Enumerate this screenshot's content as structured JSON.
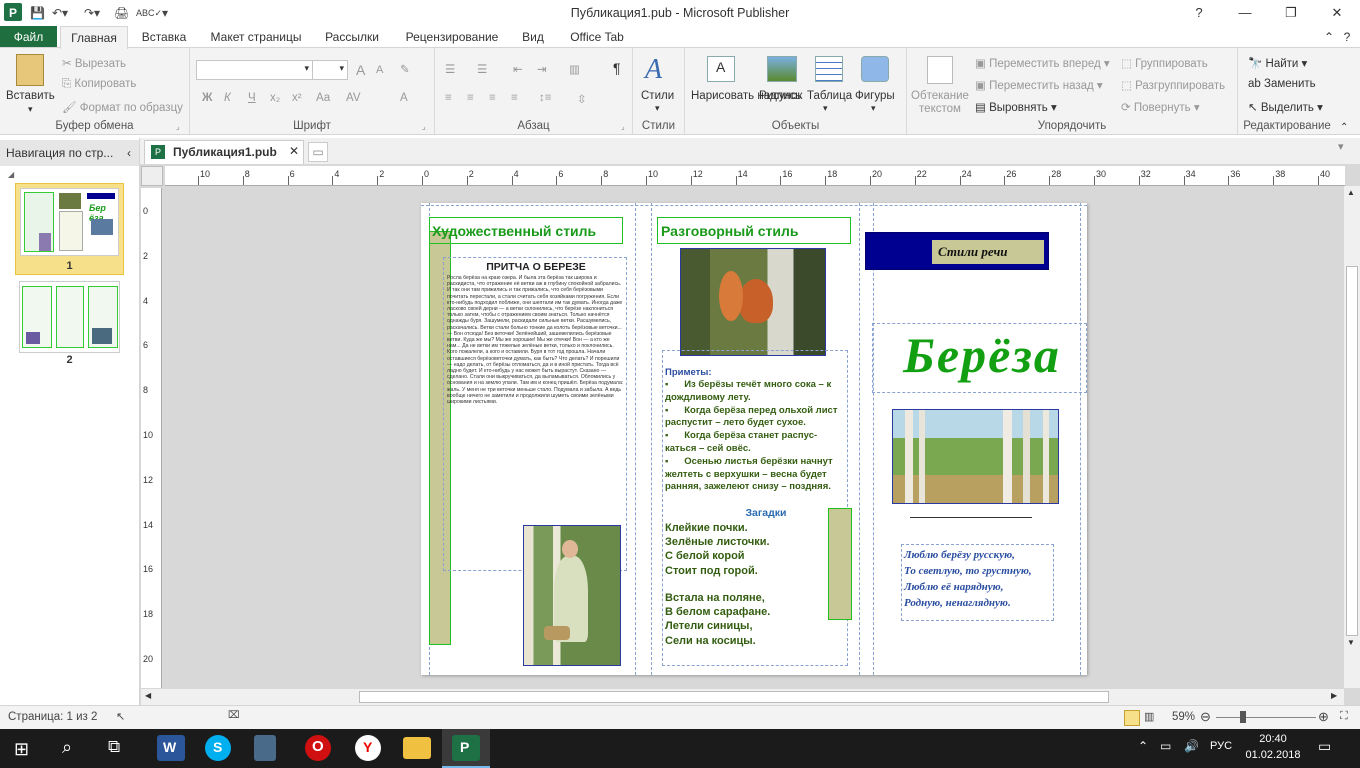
{
  "window": {
    "title": "Публикация1.pub  -  Microsoft Publisher",
    "controls": {
      "help": "?",
      "minimize": "—",
      "restore": "❐",
      "close": "✕"
    }
  },
  "ribbon_tabs": [
    "Файл",
    "Главная",
    "Вставка",
    "Макет страницы",
    "Рассылки",
    "Рецензирование",
    "Вид",
    "Office Tab"
  ],
  "ribbon": {
    "clipboard": {
      "paste": "Вставить",
      "cut": "Вырезать",
      "copy": "Копировать",
      "format_painter": "Формат по образцу",
      "label": "Буфер обмена"
    },
    "font": {
      "label": "Шрифт",
      "bold": "Ж",
      "italic": "К",
      "underline": "Ч",
      "subscript": "x₂",
      "superscript": "x²",
      "case": "Аа",
      "grow": "A",
      "shrink": "A"
    },
    "paragraph": {
      "label": "Абзац",
      "pilcrow": "¶"
    },
    "styles": {
      "label": "Стили",
      "button": "Стили"
    },
    "objects": {
      "label": "Объекты",
      "draw_text": "Нарисовать надпись",
      "picture": "Рисунок",
      "table": "Таблица",
      "shapes": "Фигуры"
    },
    "arrange": {
      "label": "Упорядочить",
      "wrap_text": "Обтекание текстом",
      "bring_forward": "Переместить вперед",
      "send_backward": "Переместить назад",
      "align": "Выровнять",
      "group": "Группировать",
      "ungroup": "Разгруппировать",
      "rotate": "Повернуть"
    },
    "editing": {
      "label": "Редактирование",
      "find": "Найти",
      "replace": "Заменить",
      "select": "Выделить"
    }
  },
  "nav_pane": {
    "title": "Навигация по стр...",
    "pages": [
      "1",
      "2"
    ]
  },
  "doc_tab": "Публикация1.pub",
  "hruler_ticks": [
    "10",
    "8",
    "6",
    "4",
    "2",
    "0",
    "2",
    "4",
    "6",
    "8",
    "10",
    "12",
    "14",
    "16",
    "18",
    "20",
    "22",
    "24",
    "26",
    "28",
    "30",
    "32",
    "34",
    "36",
    "38",
    "40"
  ],
  "vruler_ticks": [
    "0",
    "2",
    "4",
    "6",
    "8",
    "10",
    "12",
    "14",
    "16",
    "18",
    "20"
  ],
  "page": {
    "col1": {
      "header": "Художественный стиль",
      "story_title": "ПРИТЧА О БЕРЕЗЕ",
      "story_text": "Росла берёза на краю озера. И была эта берёза так широка и раскидиста, что отражение её ветви аж в глубину спокойной забрались. И так они там прижились и так прижались, что себя берёзовыми почитать перестали, а стали считать себя хозяйками погружения. Если кто-нибудь подходил поближе, они шептали им так думать. Иногда даже ласково своей дерни — а ветки склонились, что берёзе наклониться только затем, чтобы с отражением своим знаться. Только начнётся однажды буря. Зашумели, раскидали сильные ветки. Расшумелись, раскачались. Ветки стали больно тонкие да колоть берёзовые веточки... — Вон отсюда! Без веточки! Зелёнейший, зашевелились берёзовые ветви. Куда же мы? Мы же хорошие! Мы же отечки! Вон — а кто же нам... Да не ветки им тяжелые зелёные ветки, только и поклонились. Кого пожалели, а кого и оставили. Буря в тот год прошла. Начали оставшиеся берёзоветочки думать, как быть? Что делать? И порешили — надо делать, от берёзы отломаться, да и в иной пристать. Тогда всё ладно будет. И кто-нибудь у нас может быть вырастут. Сказано — сделано. Стали они выкручиваться, да выламываться. Обломились у основания и на землю упали. Там им и конец пришёл. Берёза подумала: жаль. У меня не три веточки меньше стало. Подумала и забыла. А ведь вообще ничего не заметили и продолжили шуметь своими зелёными широкими листьями."
    },
    "col2": {
      "header": "Разговорный стиль",
      "signs_title": "Приметы:",
      "signs": [
        "Из берёзы течёт много сока – к дождливому лету.",
        "Когда берёза перед ольхой лист распустит – лето будет сухое.",
        "Когда берёза станет распус-каться – сей овёс.",
        "Осенью листья берёзки начнут желтеть с верхушки – весна будет ранняя, зажелеют снизу – поздняя."
      ],
      "riddles_title": "Загадки",
      "riddle1": [
        "Клейкие почки.",
        "Зелёные листочки.",
        "С белой корой",
        "Стоит под горой."
      ],
      "riddle2": [
        "Встала на поляне,",
        "В белом сарафане.",
        "Летели синицы,",
        "Сели на косицы."
      ]
    },
    "col3": {
      "label": "Стили речи",
      "title": "Берёза",
      "poem": [
        "Люблю берёзу русскую,",
        "То светлую, то грустную,",
        "Люблю её нарядную,",
        "Родную, ненаглядную."
      ]
    }
  },
  "status": {
    "page": "Страница: 1 из 2",
    "zoom": "59%"
  },
  "taskbar": {
    "lang": "РУС",
    "time": "20:40",
    "date": "01.02.2018"
  },
  "colors": {
    "file_tab": "#1e6e3f",
    "green": "#1a9a1a",
    "navy": "#000090",
    "khaki": "#c8c896"
  }
}
